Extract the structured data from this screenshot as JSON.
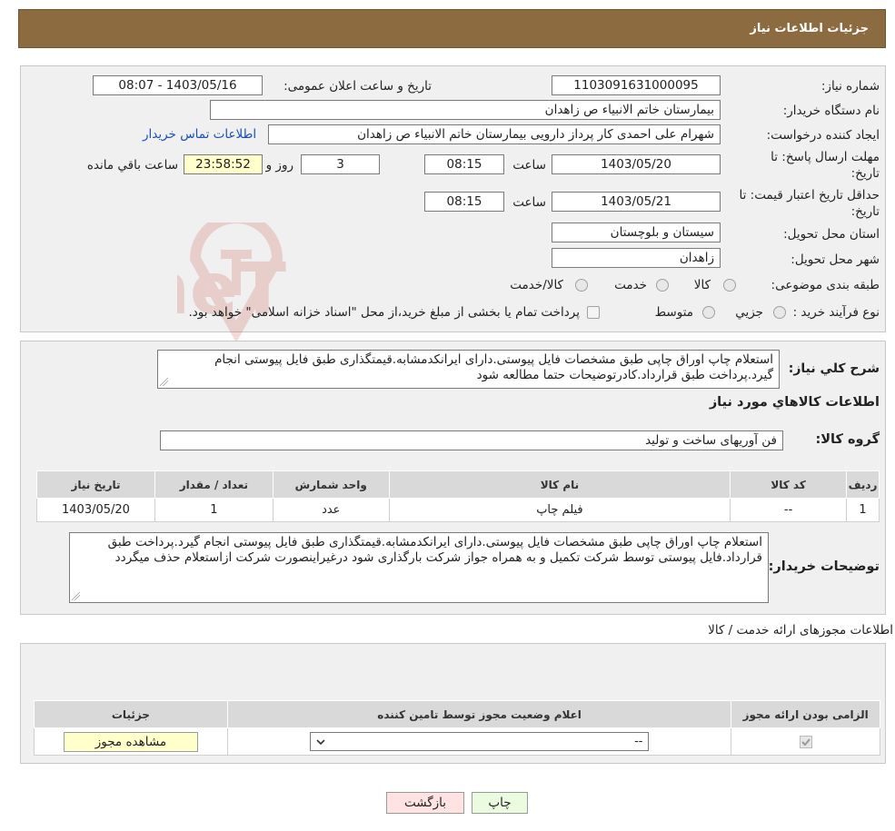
{
  "header": {
    "title": "جزئیات اطلاعات نیاز"
  },
  "details": {
    "need_number_label": "شماره نیاز:",
    "need_number": "1103091631000095",
    "announce_label": "تاریخ و ساعت اعلان عمومی:",
    "announce_value": "1403/05/16 - 08:07",
    "buyer_org_label": "نام دستگاه خریدار:",
    "buyer_org": "بیمارستان خاتم الانبیاء  ص  زاهدان",
    "requester_label": "ایجاد کننده درخواست:",
    "requester": "شهرام علی احمدی  کار پرداز دارویی  بیمارستان خاتم الانبیاء  ص  زاهدان",
    "contact_link": "اطلاعات تماس خریدار",
    "deadline_label": "مهلت ارسال پاسخ: تا تاریخ:",
    "deadline_date": "1403/05/20",
    "time_label": "ساعت",
    "deadline_time": "08:15",
    "days_count": "3",
    "days_label": "روز و",
    "remaining_time": "23:58:52",
    "remaining_label": "ساعت باقي مانده",
    "validity_label": "حداقل تاریخ اعتبار قیمت: تا تاریخ:",
    "validity_date": "1403/05/21",
    "validity_time": "08:15",
    "province_label": "استان محل تحویل:",
    "province": "سیستان و بلوچستان",
    "city_label": "شهر محل تحویل:",
    "city": "زاهدان",
    "category_label": "طبقه بندی موضوعی:",
    "category_options": [
      "کالا",
      "خدمت",
      "کالا/خدمت"
    ],
    "process_label": "نوع فرآیند خرید :",
    "process_options": [
      "جزیي",
      "متوسط"
    ],
    "process_note": "پرداخت تمام یا بخشی از مبلغ خرید،از محل \"اسناد خزانه اسلامی\" خواهد بود."
  },
  "description": {
    "summary_label": "شرح کلي نياز:",
    "summary": "استعلام چاپ اوراق چاپی طبق مشخصات فایل پیوستی.دارای ایرانکدمشابه.قیمتگذاری طبق فایل پیوستی انجام گیرد.پرداخت طبق قرارداد.کادرتوضیحات حتما مطالعه شود",
    "goods_info_title": "اطلاعات کالاهاي مورد نياز",
    "goods_group_label": "گروه کالا:",
    "goods_group": "فن آوریهای ساخت و تولید",
    "table": {
      "headers": [
        "رديف",
        "کد کالا",
        "نام کالا",
        "واحد شمارش",
        "تعداد / مقدار",
        "تاریخ نیاز"
      ],
      "rows": [
        [
          "1",
          "--",
          "فیلم چاپ",
          "عدد",
          "1",
          "1403/05/20"
        ]
      ]
    },
    "buyer_notes_label": "توضیحات خریدار:",
    "buyer_notes": "استعلام چاپ اوراق چاپی طبق مشخصات فایل پیوستی.دارای ایرانکدمشابه.قیمتگذاری طبق فایل پیوستی انجام گیرد.پرداخت طبق قرارداد.فایل پیوستی توسط شرکت تکمیل و به همراه جواز شرکت بارگذاری شود درغیراینصورت شرکت ازاستعلام حذف میگردد"
  },
  "licenses": {
    "title": "اطلاعات مجوزهای ارائه خدمت / کالا",
    "headers": [
      "الزامی بودن ارائه مجوز",
      "اعلام وضعیت مجوز توسط تامین کننده",
      "جزئیات"
    ],
    "select_value": "--",
    "view_button": "مشاهده مجوز"
  },
  "buttons": {
    "print": "چاپ",
    "back": "بازگشت"
  },
  "watermark_text": "AriaTender.neT",
  "colors": {
    "header": "#8b6b3f",
    "print_btn": "#eafbe0",
    "back_btn": "#ffe2e2",
    "time_box": "#ffffcc"
  }
}
